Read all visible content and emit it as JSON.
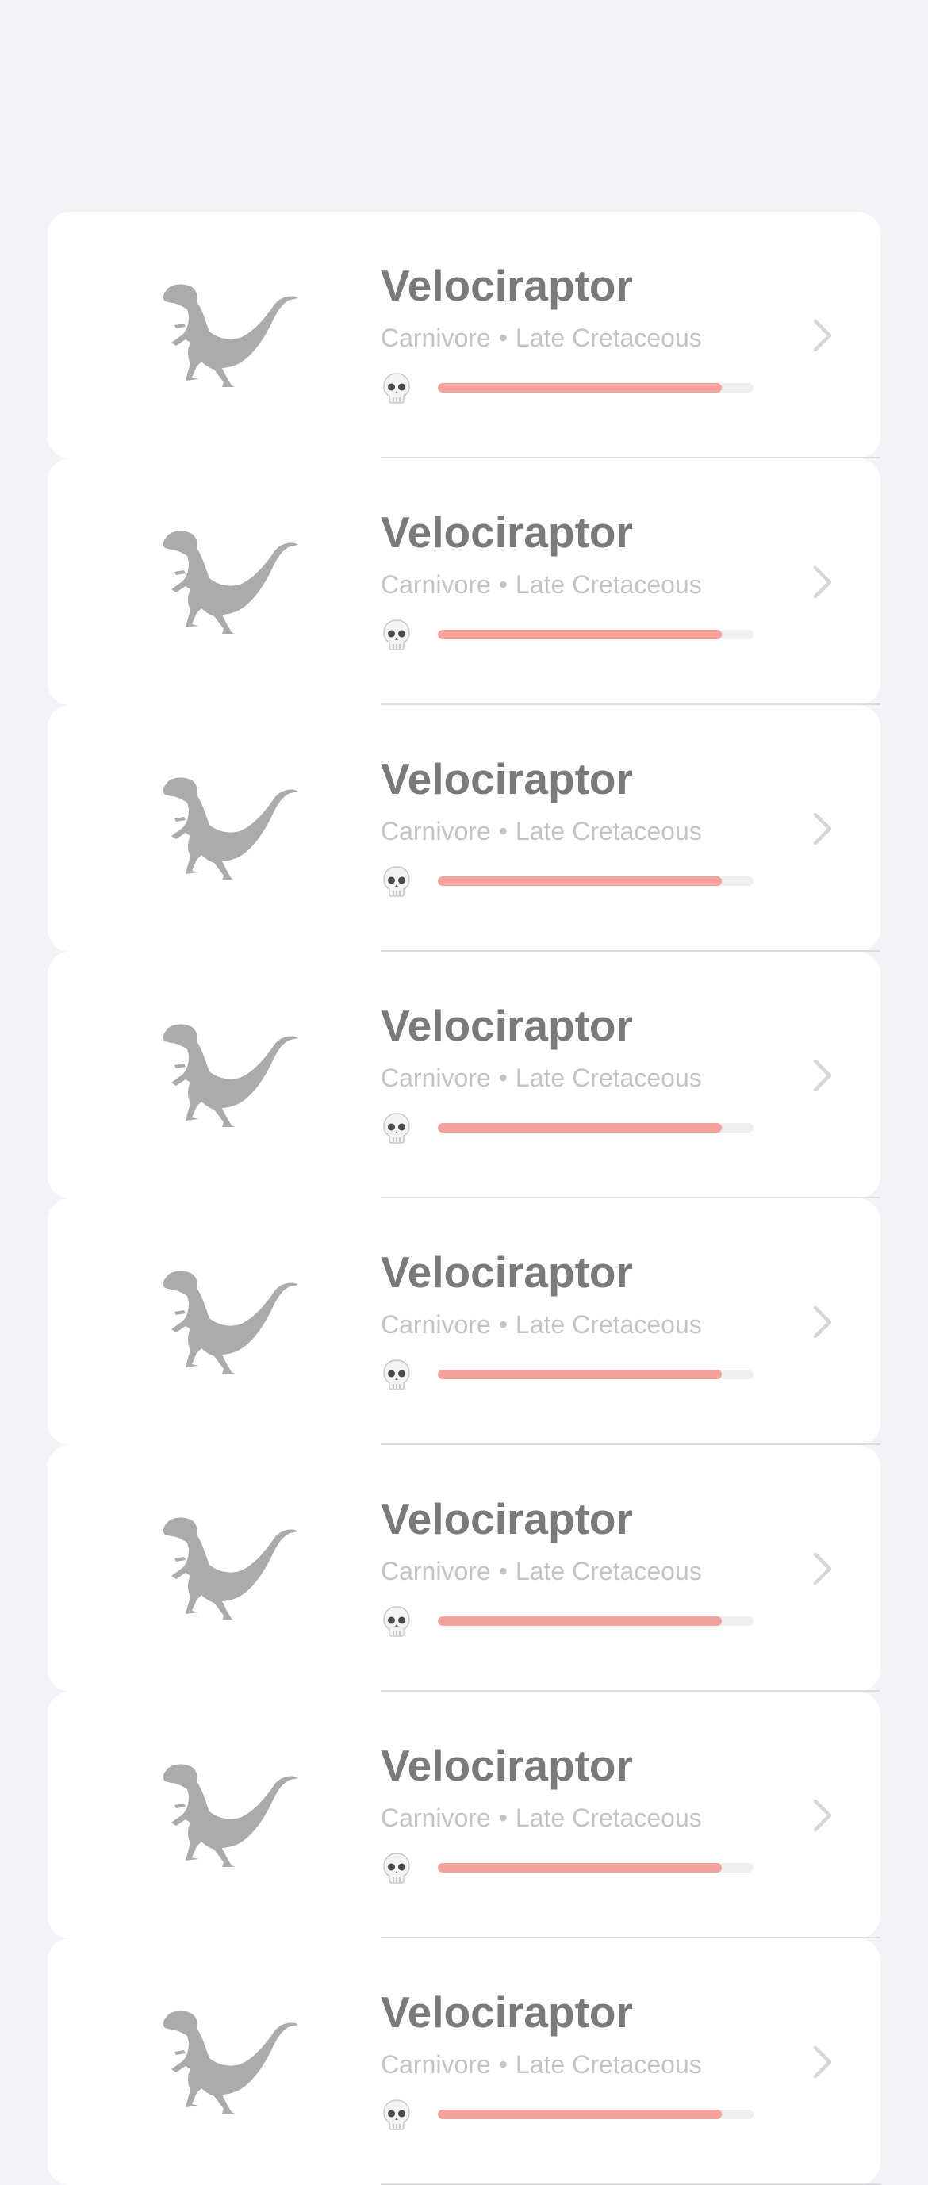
{
  "colors": {
    "background": "#f2f2f7",
    "card": "#ffffff",
    "title": "#7a7a7a",
    "subtitle": "#c4c4c6",
    "bar_fill": "#f4a19c",
    "bar_track": "#efeff1",
    "silhouette": "#ababab"
  },
  "dinosaurs": [
    {
      "name": "Velociraptor",
      "diet": "Carnivore",
      "separator": "•",
      "period": "Late Cretaceous",
      "danger_level": 0.9,
      "icon": "velociraptor-silhouette-icon"
    },
    {
      "name": "Velociraptor",
      "diet": "Carnivore",
      "separator": "•",
      "period": "Late Cretaceous",
      "danger_level": 0.9,
      "icon": "velociraptor-silhouette-icon"
    },
    {
      "name": "Velociraptor",
      "diet": "Carnivore",
      "separator": "•",
      "period": "Late Cretaceous",
      "danger_level": 0.9,
      "icon": "velociraptor-silhouette-icon"
    },
    {
      "name": "Velociraptor",
      "diet": "Carnivore",
      "separator": "•",
      "period": "Late Cretaceous",
      "danger_level": 0.9,
      "icon": "velociraptor-silhouette-icon"
    },
    {
      "name": "Velociraptor",
      "diet": "Carnivore",
      "separator": "•",
      "period": "Late Cretaceous",
      "danger_level": 0.9,
      "icon": "velociraptor-silhouette-icon"
    },
    {
      "name": "Velociraptor",
      "diet": "Carnivore",
      "separator": "•",
      "period": "Late Cretaceous",
      "danger_level": 0.9,
      "icon": "velociraptor-silhouette-icon"
    },
    {
      "name": "Velociraptor",
      "diet": "Carnivore",
      "separator": "•",
      "period": "Late Cretaceous",
      "danger_level": 0.9,
      "icon": "velociraptor-silhouette-icon"
    },
    {
      "name": "Velociraptor",
      "diet": "Carnivore",
      "separator": "•",
      "period": "Late Cretaceous",
      "danger_level": 0.9,
      "icon": "velociraptor-silhouette-icon"
    }
  ]
}
